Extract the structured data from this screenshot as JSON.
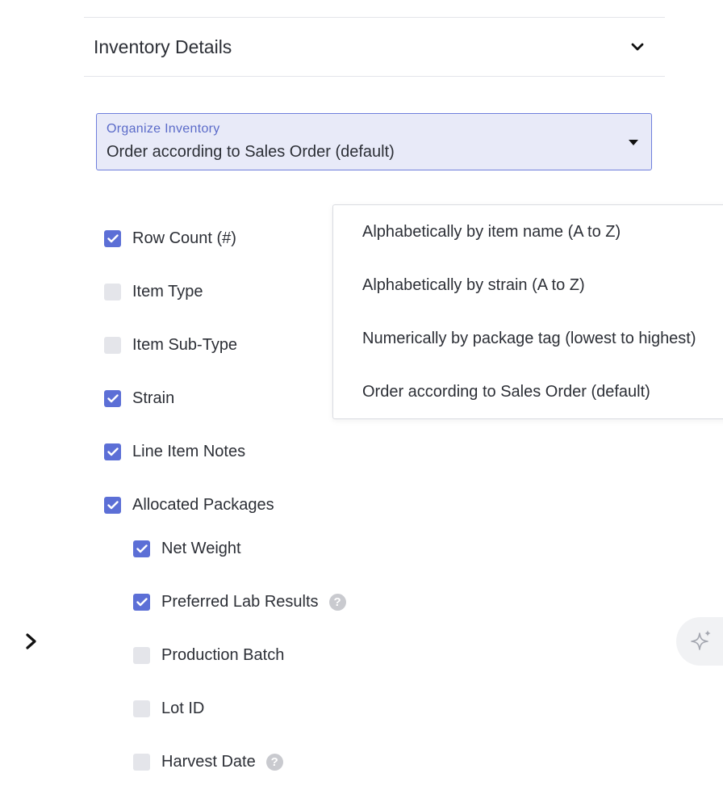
{
  "section": {
    "title": "Inventory Details"
  },
  "organize": {
    "label": "Organize Inventory",
    "value": "Order according to Sales Order (default)",
    "options": [
      "Alphabetically by item name (A to Z)",
      "Alphabetically by strain (A to Z)",
      "Numerically by package tag (lowest to highest)",
      "Order according to Sales Order (default)"
    ]
  },
  "checkboxes": [
    {
      "label": "Row Count (#)",
      "checked": true
    },
    {
      "label": "Item Type",
      "checked": false
    },
    {
      "label": "Item Sub-Type",
      "checked": false
    },
    {
      "label": "Strain",
      "checked": true
    },
    {
      "label": "Line Item Notes",
      "checked": true
    },
    {
      "label": "Allocated Packages",
      "checked": true
    }
  ],
  "package_options": [
    {
      "label": "Net Weight",
      "checked": true,
      "help": false
    },
    {
      "label": "Preferred Lab Results",
      "checked": true,
      "help": true
    },
    {
      "label": "Production Batch",
      "checked": false,
      "help": false
    },
    {
      "label": "Lot ID",
      "checked": false,
      "help": false
    },
    {
      "label": "Harvest Date",
      "checked": false,
      "help": true
    }
  ],
  "help_glyph": "?",
  "colors": {
    "accent": "#5c6fd6",
    "select_bg": "#e8eaf8",
    "unchecked": "#e4e5ea"
  }
}
